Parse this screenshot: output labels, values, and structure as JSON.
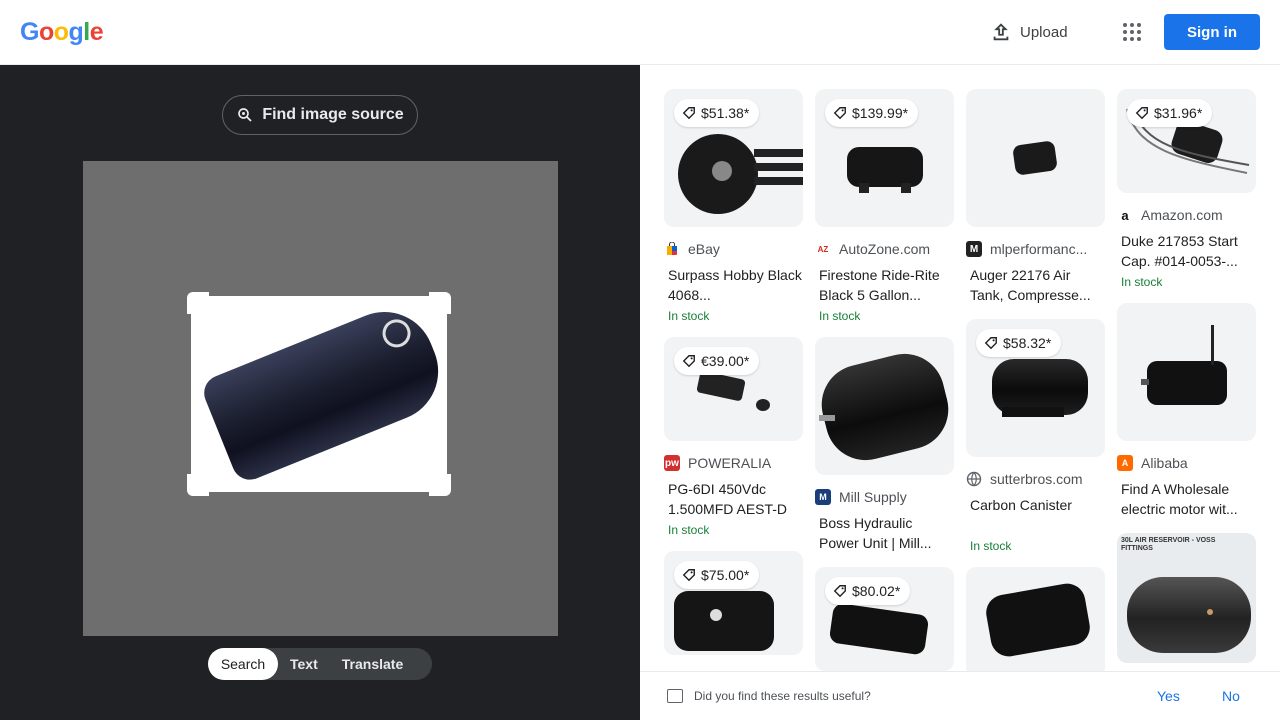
{
  "header": {
    "logo_letters": [
      "G",
      "o",
      "o",
      "g",
      "l",
      "e"
    ],
    "logo_colors": [
      "#4285f4",
      "#ea4335",
      "#fbbc05",
      "#4285f4",
      "#34a853",
      "#ea4335"
    ],
    "upload_label": "Upload",
    "apps_icon": "apps-grid-icon",
    "signin_label": "Sign in"
  },
  "left": {
    "find_source_label": "Find image source",
    "modes": [
      "Search",
      "Text",
      "Translate"
    ],
    "active_mode": "Search"
  },
  "results": [
    {
      "price": "$51.38*",
      "source": "eBay",
      "title": "Surpass Hobby Black 4068...",
      "stock": "In stock"
    },
    {
      "price": "€39.00*",
      "source": "POWERALIA",
      "title": "PG-6DI 450Vdc 1.500MFD AEST-D",
      "stock": "In stock"
    },
    {
      "price": "$75.00*",
      "source": "",
      "title": "",
      "stock": ""
    },
    {
      "price": "$139.99*",
      "source": "AutoZone.com",
      "title": "Firestone Ride-Rite Black 5 Gallon...",
      "stock": "In stock"
    },
    {
      "price": "",
      "source": "Mill Supply",
      "title": "Boss Hydraulic Power Unit | Mill...",
      "stock": ""
    },
    {
      "price": "$80.02*",
      "source": "",
      "title": "",
      "stock": ""
    },
    {
      "price": "",
      "source": "mlperformanc...",
      "title": "Auger 22176 Air Tank, Compresse...",
      "stock": ""
    },
    {
      "price": "$58.32*",
      "source": "sutterbros.com",
      "title": "Carbon Canister",
      "stock": "In stock"
    },
    {
      "price": "",
      "source": "",
      "title": "",
      "stock": ""
    },
    {
      "price": "$31.96*",
      "source": "Amazon.com",
      "title": "Duke 217853 Start Cap. #014-0053-...",
      "stock": "In stock"
    },
    {
      "price": "",
      "source": "Alibaba",
      "title": "Find A Wholesale electric motor wit...",
      "stock": ""
    },
    {
      "price": "",
      "source": "",
      "title": "",
      "stock": "",
      "overlay_text": "30L AIR RESERVOIR - VOSS FITTINGS"
    }
  ],
  "feedback": {
    "question": "Did you find these results useful?",
    "yes_label": "Yes",
    "no_label": "No"
  }
}
